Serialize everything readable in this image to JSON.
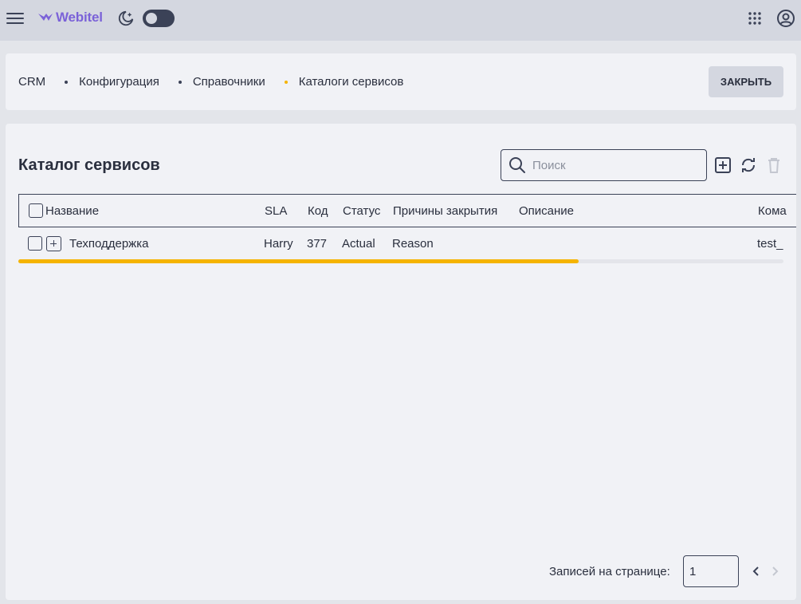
{
  "header": {
    "logo_text": "Webitel",
    "icons": [
      "menu-icon",
      "webitel-logo-icon",
      "dark-mode-icon",
      "apps-grid-icon",
      "account-icon"
    ],
    "theme_toggle": "off"
  },
  "breadcrumb": {
    "items": [
      "CRM",
      "Конфигурация",
      "Справочники",
      "Каталоги сервисов"
    ],
    "close_label": "ЗАКРЫТЬ"
  },
  "main": {
    "title": "Каталог сервисов",
    "search": {
      "placeholder": "Поиск",
      "value": ""
    },
    "actions": [
      "add-icon",
      "refresh-icon",
      "delete-icon"
    ],
    "columns": [
      "Название",
      "SLA",
      "Код",
      "Статус",
      "Причины закрытия",
      "Описание",
      "Кома"
    ],
    "rows": [
      {
        "name": "Техподдержка",
        "sla": "Harry",
        "code": "377",
        "status": "Actual",
        "reason": "Reason",
        "description": "",
        "team": "test_"
      }
    ]
  },
  "pagination": {
    "label": "Записей на странице:",
    "per_page": "1"
  },
  "colors": {
    "accent": "#f5b400",
    "brand": "#7b62d8",
    "text": "#2a2f3e",
    "header_bg": "#d4d7e0"
  }
}
